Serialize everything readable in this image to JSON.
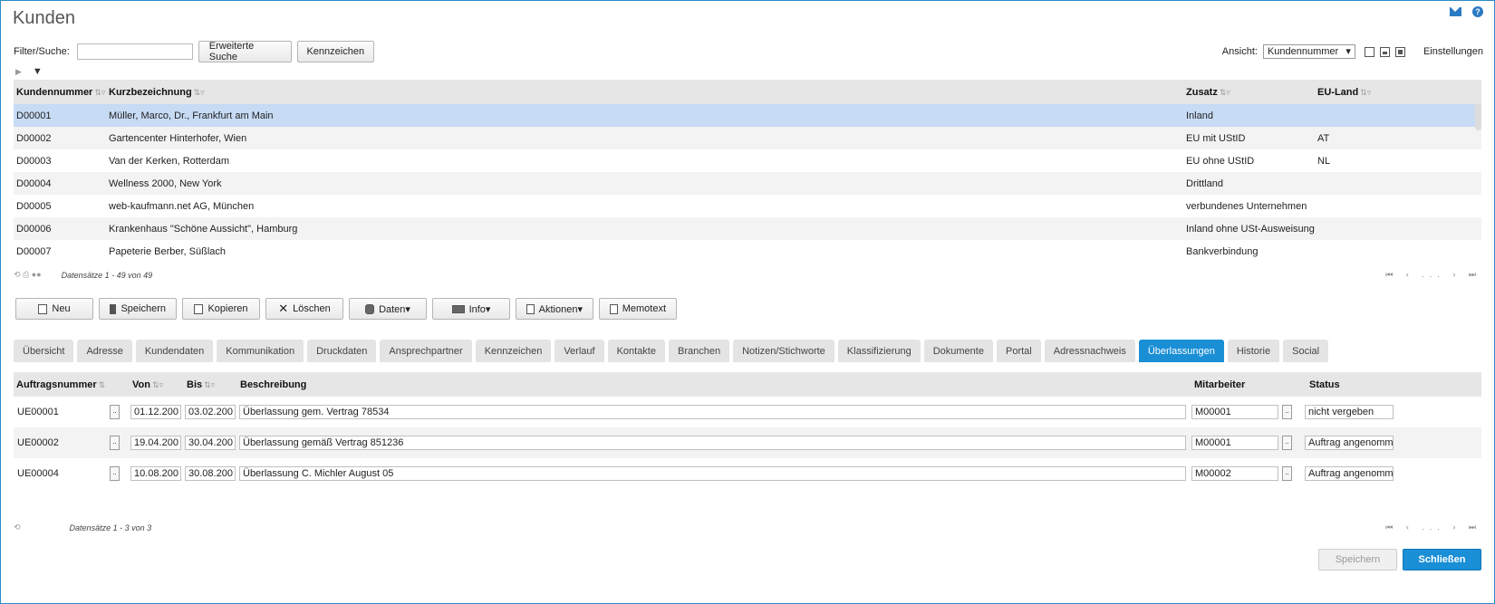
{
  "page": {
    "title": "Kunden"
  },
  "filter": {
    "label": "Filter/Suche:",
    "value": "",
    "extended_search": "Erweiterte Suche",
    "tags": "Kennzeichen",
    "view_label": "Ansicht:",
    "view_value": "Kundennummer",
    "settings": "Einstellungen"
  },
  "customers": {
    "columns": [
      "Kundennummer",
      "Kurzbezeichnung",
      "Zusatz",
      "EU-Land"
    ],
    "rows": [
      {
        "nr": "D00001",
        "name": "Müller, Marco, Dr., Frankfurt am Main",
        "zusatz": "Inland",
        "eu": ""
      },
      {
        "nr": "D00002",
        "name": "Gartencenter Hinterhofer, Wien",
        "zusatz": "EU mit UStID",
        "eu": "AT"
      },
      {
        "nr": "D00003",
        "name": "Van der Kerken, Rotterdam",
        "zusatz": "EU ohne UStID",
        "eu": "NL"
      },
      {
        "nr": "D00004",
        "name": "Wellness 2000, New York",
        "zusatz": "Drittland",
        "eu": ""
      },
      {
        "nr": "D00005",
        "name": "web-kaufmann.net AG, München",
        "zusatz": "verbundenes Unternehmen",
        "eu": ""
      },
      {
        "nr": "D00006",
        "name": "Krankenhaus \"Schöne Aussicht\", Hamburg",
        "zusatz": "Inland ohne USt-Ausweisung",
        "eu": ""
      },
      {
        "nr": "D00007",
        "name": "Papeterie Berber, Süßlach",
        "zusatz": "Bankverbindung",
        "eu": ""
      }
    ],
    "records": "Datensätze 1 - 49 von 49",
    "pager": "⏮ ‹ ... › ⏭"
  },
  "actions": {
    "new": "Neu",
    "save": "Speichern",
    "copy": "Kopieren",
    "delete": "Löschen",
    "data": "Daten▾",
    "info": "Info▾",
    "actions": "Aktionen▾",
    "memo": "Memotext"
  },
  "tabs": [
    "Übersicht",
    "Adresse",
    "Kundendaten",
    "Kommunikation",
    "Druckdaten",
    "Ansprechpartner",
    "Kennzeichen",
    "Verlauf",
    "Kontakte",
    "Branchen",
    "Notizen/Stichworte",
    "Klassifizierung",
    "Dokumente",
    "Portal",
    "Adressnachweis",
    "Überlassungen",
    "Historie",
    "Social"
  ],
  "active_tab": "Überlassungen",
  "orders": {
    "columns": [
      "Auftragsnummer",
      "Von",
      "Bis",
      "Beschreibung",
      "Mitarbeiter",
      "Status"
    ],
    "rows": [
      {
        "nr": "UE00001",
        "von": "01.12.200",
        "bis": "03.02.200",
        "desc": "Überlassung gem. Vertrag 78534",
        "emp": "M00001",
        "status": "nicht vergeben"
      },
      {
        "nr": "UE00002",
        "von": "19.04.200",
        "bis": "30.04.200",
        "desc": "Überlassung gemäß Vertrag 851236",
        "emp": "M00001",
        "status": "Auftrag angenomme"
      },
      {
        "nr": "UE00004",
        "von": "10.08.200",
        "bis": "30.08.200",
        "desc": "Überlassung C. Michler August 05",
        "emp": "M00002",
        "status": "Auftrag angenomme"
      }
    ],
    "records": "Datensätze 1 - 3 von 3",
    "pager": "⏮ ‹ ... › ⏭",
    "dots": ".."
  },
  "bottom": {
    "save": "Speichern",
    "close": "Schließen"
  }
}
